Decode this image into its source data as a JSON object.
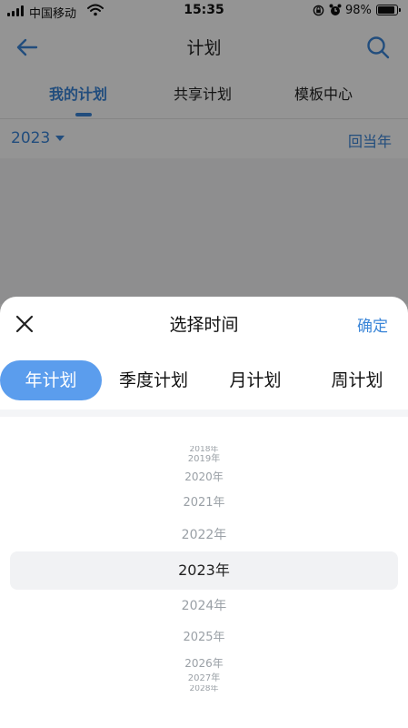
{
  "status_bar": {
    "carrier": "中国移动",
    "time": "15:35",
    "battery": "98%"
  },
  "header": {
    "title": "计划"
  },
  "tabs": [
    {
      "label": "我的计划",
      "active": true
    },
    {
      "label": "共享计划"
    },
    {
      "label": "模板中心"
    }
  ],
  "year_row": {
    "year": "2023",
    "back_label": "回当年"
  },
  "sheet": {
    "title": "选择时间",
    "confirm": "确定",
    "segments": [
      {
        "label": "年计划",
        "active": true
      },
      {
        "label": "季度计划"
      },
      {
        "label": "月计划"
      },
      {
        "label": "周计划"
      }
    ],
    "years": [
      "2018年",
      "2019年",
      "2020年",
      "2021年",
      "2022年",
      "2023年",
      "2024年",
      "2025年",
      "2026年",
      "2027年",
      "2028年"
    ],
    "selected_year": "2023年"
  },
  "colors": {
    "accent": "#3b86d8",
    "segment_active": "#5b9ded"
  },
  "icons": [
    "back-arrow-icon",
    "search-icon",
    "close-icon",
    "wifi-icon",
    "lock-rotation-icon",
    "alarm-icon",
    "battery-icon"
  ]
}
